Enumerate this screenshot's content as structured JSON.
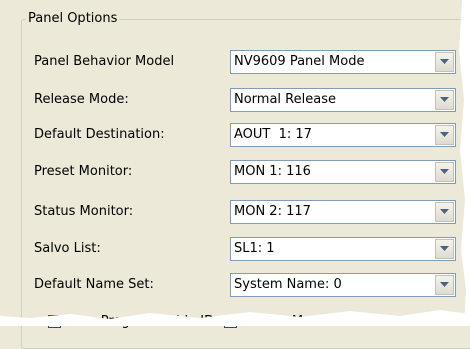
{
  "panel_options": {
    "title": "Panel Options",
    "rows": [
      {
        "label": "Panel Behavior Model",
        "value": "NV9609 Panel Mode"
      },
      {
        "label": "Release Mode:",
        "value": "Normal Release"
      },
      {
        "label": "Default Destination:",
        "value": "AOUT  1: 17"
      },
      {
        "label": "Preset Monitor:",
        "value": "MON 1: 116"
      },
      {
        "label": "Status Monitor:",
        "value": "MON 2: 117"
      },
      {
        "label": "Salvo List:",
        "value": "SL1: 1"
      },
      {
        "label": "Default Name Set:",
        "value": "System Name: 0"
      }
    ],
    "checkboxes": [
      {
        "label": "User Programmable ID"
      },
      {
        "label": "Screen Monitor ..."
      }
    ]
  },
  "icons": {
    "dropdown": "chevron-down-icon"
  },
  "colors": {
    "background": "#ece9d8",
    "field_border": "#7f9db9",
    "group_border": "#d0d0bf"
  }
}
